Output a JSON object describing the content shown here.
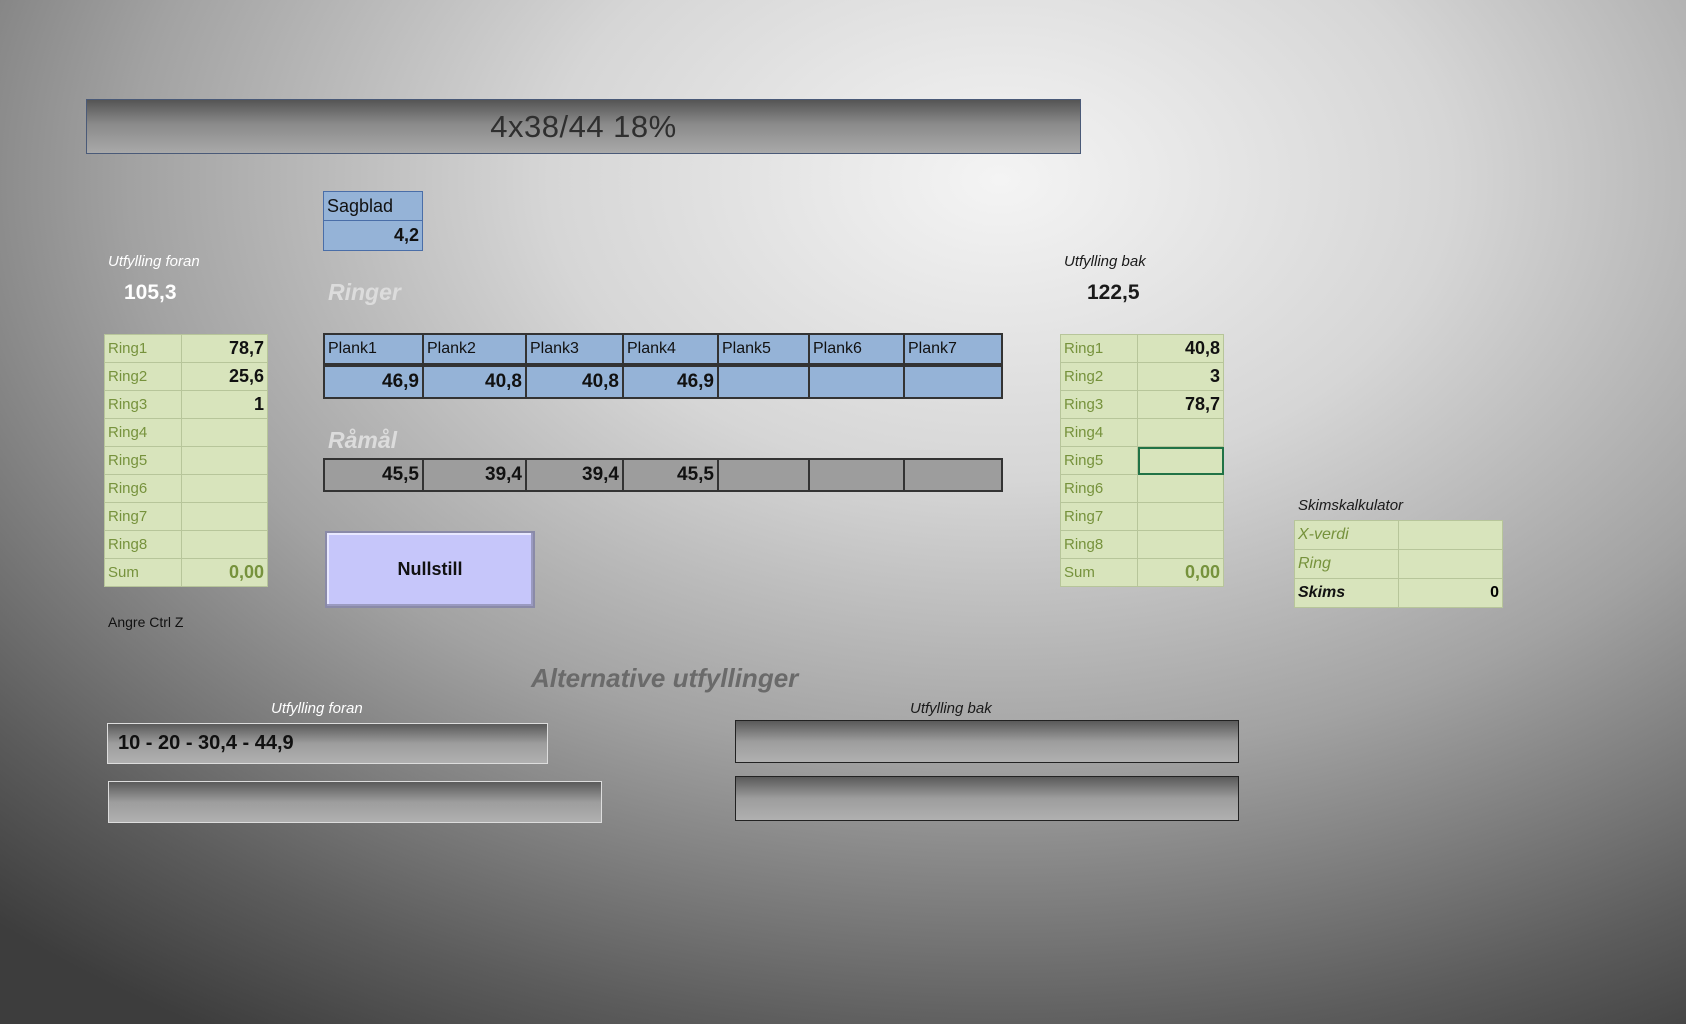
{
  "title": "4x38/44 18%",
  "sagblad": {
    "label": "Sagblad",
    "value": "4,2"
  },
  "front": {
    "label": "Utfylling foran",
    "total": "105,3",
    "rings": [
      {
        "label": "Ring1",
        "value": "78,7"
      },
      {
        "label": "Ring2",
        "value": "25,6"
      },
      {
        "label": "Ring3",
        "value": "1"
      },
      {
        "label": "Ring4",
        "value": ""
      },
      {
        "label": "Ring5",
        "value": ""
      },
      {
        "label": "Ring6",
        "value": ""
      },
      {
        "label": "Ring7",
        "value": ""
      },
      {
        "label": "Ring8",
        "value": ""
      }
    ],
    "sum": {
      "label": "Sum",
      "value": "0,00"
    },
    "undo_hint": "Angre Ctrl Z"
  },
  "back": {
    "label": "Utfylling bak",
    "total": "122,5",
    "rings": [
      {
        "label": "Ring1",
        "value": "40,8"
      },
      {
        "label": "Ring2",
        "value": "3"
      },
      {
        "label": "Ring3",
        "value": "78,7"
      },
      {
        "label": "Ring4",
        "value": ""
      },
      {
        "label": "Ring5",
        "value": ""
      },
      {
        "label": "Ring6",
        "value": ""
      },
      {
        "label": "Ring7",
        "value": ""
      },
      {
        "label": "Ring8",
        "value": ""
      }
    ],
    "sum": {
      "label": "Sum",
      "value": "0,00"
    }
  },
  "ringer": {
    "heading": "Ringer",
    "planks": [
      "Plank1",
      "Plank2",
      "Plank3",
      "Plank4",
      "Plank5",
      "Plank6",
      "Plank7"
    ],
    "values": [
      "46,9",
      "40,8",
      "40,8",
      "46,9",
      "",
      "",
      ""
    ]
  },
  "ramal": {
    "heading": "Råmål",
    "values": [
      "45,5",
      "39,4",
      "39,4",
      "45,5",
      "",
      "",
      ""
    ]
  },
  "reset_button": "Nullstill",
  "skims": {
    "heading": "Skimskalkulator",
    "rows": [
      {
        "label": "X-verdi",
        "value": ""
      },
      {
        "label": "Ring",
        "value": ""
      },
      {
        "label": "Skims",
        "value": "0"
      }
    ]
  },
  "alternatives": {
    "heading": "Alternative utfyllinger",
    "front_label": "Utfylling foran",
    "back_label": "Utfylling bak",
    "front_values": [
      "10 - 20 - 30,4 - 44,9",
      ""
    ],
    "back_values": [
      "",
      ""
    ]
  },
  "colors": {
    "ring_cell": "#d8e4bc",
    "ring_label": "#76923c",
    "plank_blue": "#95b3d7",
    "button": "#c6c6fa"
  }
}
